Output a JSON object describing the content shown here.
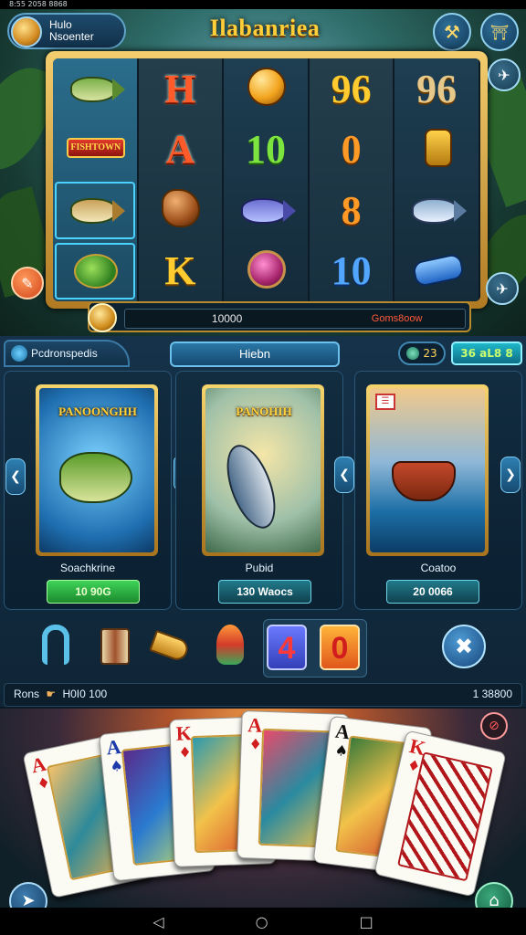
{
  "status_bar": {
    "left_text": "8:55 2058 8868"
  },
  "header": {
    "profile_line1": "Hulo",
    "profile_line2": "Nsoenter",
    "title": "Ilabanriea",
    "btn_left_icon": "hammer-icon",
    "btn_right_icon": "fence-icon"
  },
  "reels": {
    "col1": [
      "fish-jump",
      "banner",
      "fish-small",
      "leaf"
    ],
    "banner_text": "FISHTOWN",
    "col2": [
      "H",
      "A",
      "K"
    ],
    "col3": [
      "gem",
      "10",
      "fish-purple",
      "skull"
    ],
    "col4": [
      "96",
      "0",
      "8",
      "10"
    ],
    "col5": [
      "96",
      "hose",
      "fish-jump2",
      "bottle"
    ]
  },
  "bet": {
    "amount": "10000",
    "win": "Goms8oow"
  },
  "panel": {
    "tab_label": "Pcdronspedis",
    "center_tab": "Hiebn",
    "coins": "23",
    "cash": "36 aL8 8"
  },
  "cards": [
    {
      "title": "PANOONGHH",
      "name": "Soachkrine",
      "price": "10 90G",
      "style": "green"
    },
    {
      "title": "PANOHIH",
      "name": "Pubid",
      "price": "130 Waocs",
      "style": "teal"
    },
    {
      "title": "",
      "name": "Coatoo",
      "price": "20 0066",
      "style": "teal"
    }
  ],
  "number_tiles": [
    "4",
    "0"
  ],
  "info": {
    "left_label": "Rons",
    "left_value": "H0I0 100",
    "right_value": "1 38800"
  },
  "play_cards": [
    {
      "rank": "A",
      "suit": "♦",
      "color": "red"
    },
    {
      "rank": "A",
      "suit": "♠",
      "color": "blue"
    },
    {
      "rank": "K",
      "suit": "♦",
      "color": "red"
    },
    {
      "rank": "A",
      "suit": "♦",
      "color": "red"
    },
    {
      "rank": "A",
      "suit": "♠",
      "color": "black"
    },
    {
      "rank": "K",
      "suit": "♦",
      "color": "red"
    }
  ],
  "colors": {
    "gold": "#ffcf3a",
    "panel": "#15324a",
    "accent": "#6cc0ec"
  }
}
